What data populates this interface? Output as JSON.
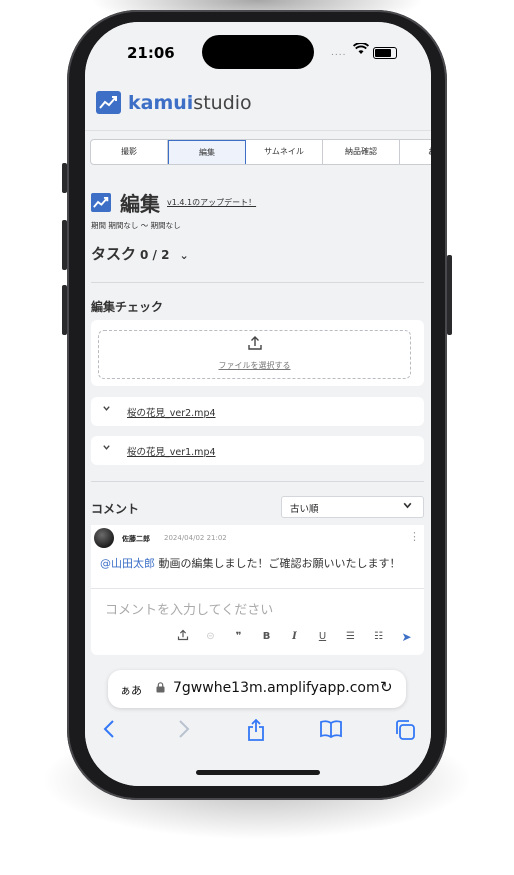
{
  "status": {
    "time": "21:06",
    "signal": "....",
    "wifi": "wifi-icon",
    "battery": "battery-icon"
  },
  "brand": {
    "kamui": "kamui",
    "studio": "studio",
    "icon": "chart-line-icon"
  },
  "tabs": [
    {
      "label": "撮影",
      "active": false
    },
    {
      "label": "編集",
      "active": true
    },
    {
      "label": "サムネイル",
      "active": false
    },
    {
      "label": "納品確認",
      "active": false
    },
    {
      "label": "お",
      "active": false
    }
  ],
  "page": {
    "title": "編集",
    "update_link": "v1.4.1のアップデート！",
    "period": "期間  期間なし ～ 期間なし",
    "tasks_label": "タスク",
    "tasks_count": "0 / 2",
    "tasks_chevron": "⌄"
  },
  "edit_check": {
    "heading": "編集チェック",
    "upload_icon": "upload-icon",
    "upload_label": "ファイルを選択する",
    "files": [
      {
        "name": "桜の花見_ver2.mp4"
      },
      {
        "name": "桜の花見_ver1.mp4"
      }
    ]
  },
  "comments": {
    "heading": "コメント",
    "sort_value": "古い順",
    "items": [
      {
        "user": "佐藤二郎",
        "date": "2024/04/02 21:02",
        "mention": "@山田太郎",
        "text": " 動画の編集しました！ご確認お願いいたします！"
      }
    ],
    "composer_placeholder": "コメントを入力してください",
    "toolbar": [
      "upload-icon",
      "link-icon",
      "quote-icon",
      "bold-icon",
      "italic-icon",
      "underline-icon",
      "bullet-list-icon",
      "numbered-list-icon",
      "send-icon"
    ]
  },
  "safari": {
    "aa": "ぁあ",
    "url": "7gwwhe13m.amplifyapp.com"
  },
  "colors": {
    "accent": "#3d6fc7",
    "background": "#f1f2f4"
  }
}
